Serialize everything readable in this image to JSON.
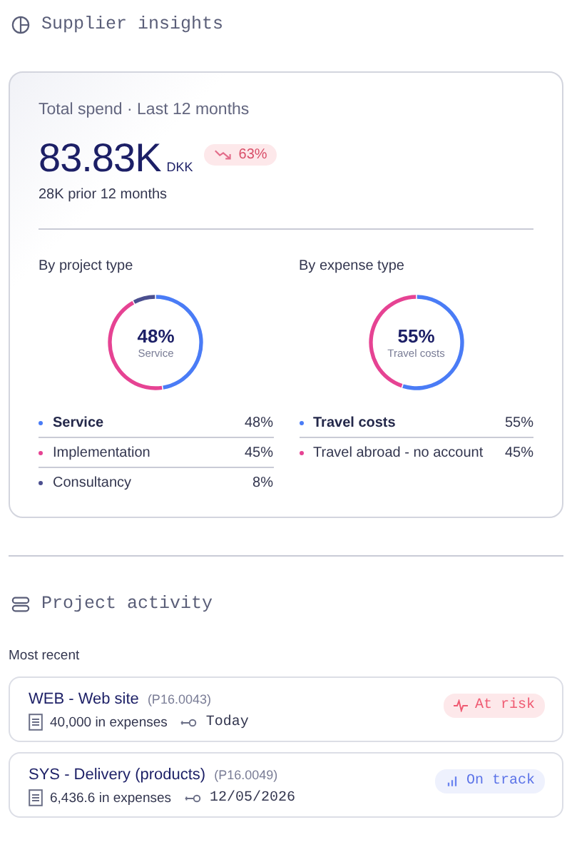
{
  "insights": {
    "title": "Supplier insights",
    "card": {
      "caption": "Total spend · Last 12 months",
      "amount": "83.83K",
      "currency": "DKK",
      "change": {
        "text": "63%",
        "kind": "decrease"
      },
      "prior": "28K prior 12 months",
      "breakdowns": [
        {
          "title": "By project type",
          "center_value": "48%",
          "center_label": "Service",
          "chart_data": {
            "type": "donut",
            "values": [
              48,
              45,
              8
            ]
          },
          "legend": [
            {
              "label": "Service",
              "value": "48%",
              "color": "#4a7cf6",
              "highlighted": true
            },
            {
              "label": "Implementation",
              "value": "45%",
              "color": "#e64393",
              "highlighted": false
            },
            {
              "label": "Consultancy",
              "value": "8%",
              "color": "#4b4f8f",
              "highlighted": false
            }
          ]
        },
        {
          "title": "By expense type",
          "center_value": "55%",
          "center_label": "Travel costs",
          "chart_data": {
            "type": "donut",
            "values": [
              55,
              45
            ]
          },
          "legend": [
            {
              "label": "Travel costs",
              "value": "55%",
              "color": "#4a7cf6",
              "highlighted": true
            },
            {
              "label": "Travel abroad - no account",
              "value": "45%",
              "color": "#e64393",
              "highlighted": false
            }
          ]
        }
      ]
    }
  },
  "activity": {
    "title": "Project activity",
    "subtitle": "Most recent",
    "projects": [
      {
        "name": "WEB - Web site",
        "code": "(P16.0043)",
        "expenses": "40,000 in expenses",
        "date": "Today",
        "status": {
          "kind": "risk",
          "label": "At risk"
        }
      },
      {
        "name": "SYS - Delivery (products)",
        "code": "(P16.0049)",
        "expenses": "6,436.6 in expenses",
        "date": "12/05/2026",
        "status": {
          "kind": "track",
          "label": "On track"
        }
      }
    ]
  }
}
